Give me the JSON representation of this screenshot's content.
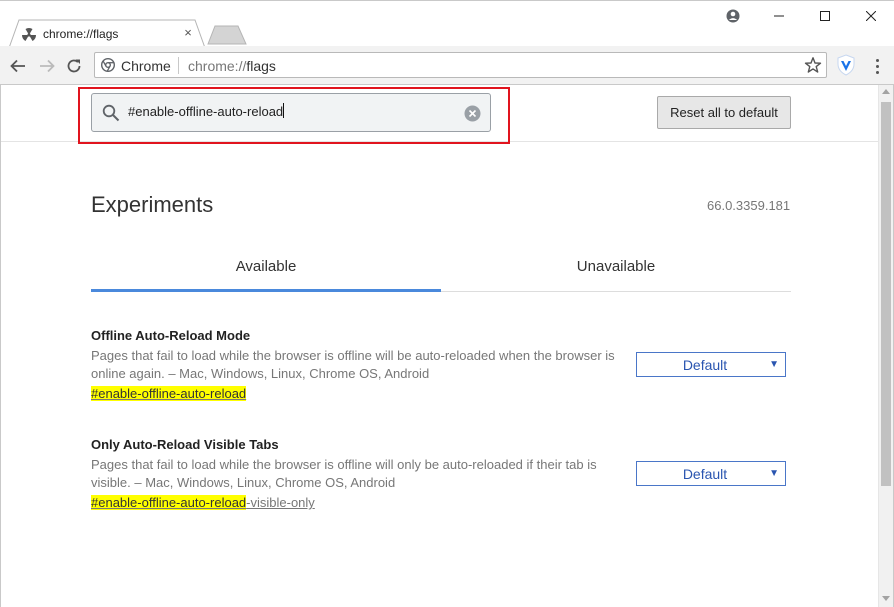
{
  "window": {
    "tab_title": "chrome://flags",
    "tab_close": "×"
  },
  "toolbar": {
    "site_chip": "Chrome",
    "url_scheme": "chrome://",
    "url_host": "flags"
  },
  "flags_header": {
    "search_value": "#enable-offline-auto-reload",
    "reset_label": "Reset all to default"
  },
  "main": {
    "title": "Experiments",
    "version": "66.0.3359.181",
    "tabs": [
      {
        "label": "Available",
        "active": true
      },
      {
        "label": "Unavailable",
        "active": false
      }
    ],
    "experiments": [
      {
        "name": "Offline Auto-Reload Mode",
        "description": "Pages that fail to load while the browser is offline will be auto-reloaded when the browser is online again. – Mac, Windows, Linux, Chrome OS, Android",
        "link_match": "#enable-offline-auto-reload",
        "link_rest": "",
        "value": "Default"
      },
      {
        "name": "Only Auto-Reload Visible Tabs",
        "description": "Pages that fail to load while the browser is offline will only be auto-reloaded if their tab is visible. – Mac, Windows, Linux, Chrome OS, Android",
        "link_match": "#enable-offline-auto-reload",
        "link_rest": "-visible-only",
        "value": "Default"
      }
    ]
  },
  "colors": {
    "highlight_box": "#e1141e",
    "active_tab_underline": "#4a89dc",
    "search_match": "#ffff00",
    "select_text": "#2a55b0"
  },
  "icons": {
    "tab_favicon": "flags-radiation-icon",
    "back": "back-arrow-icon",
    "forward": "forward-arrow-icon",
    "reload": "reload-icon",
    "site_chip": "chrome-logo-icon",
    "star": "star-icon",
    "extension": "vpn-shield-icon",
    "menu": "three-dot-menu-icon",
    "search": "search-icon",
    "clear": "clear-circle-icon"
  }
}
